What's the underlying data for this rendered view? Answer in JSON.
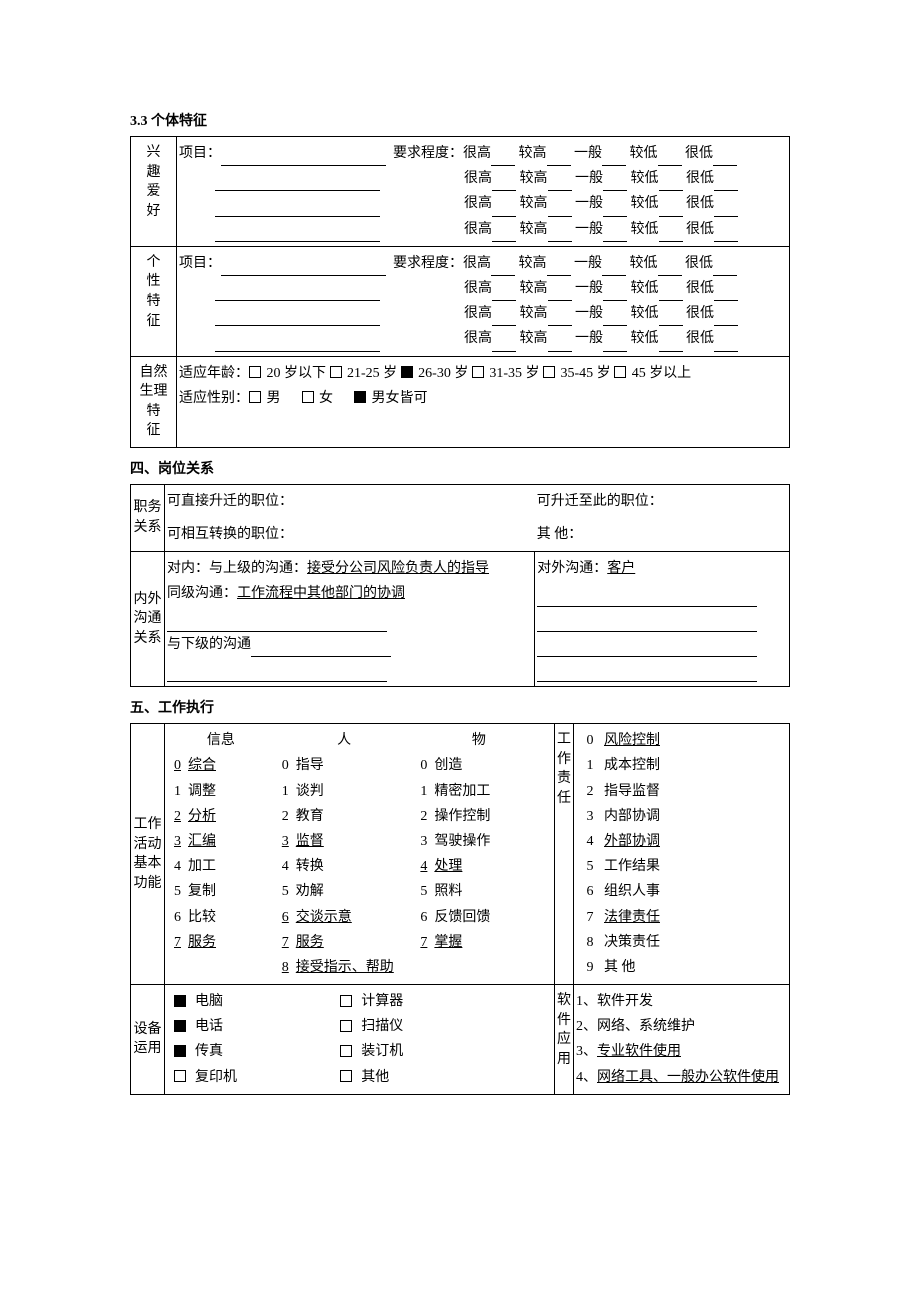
{
  "s33": {
    "title": "3.3 个体特征",
    "interest_label": "兴趣爱好",
    "personality_label": "个性特征",
    "project_label": "项目：",
    "require_label": "要求程度：",
    "levels": [
      "很高",
      "较高",
      "一般",
      "较低",
      "很低"
    ],
    "physio": {
      "label": "自然生理特征",
      "age_label": "适应年龄：",
      "ages": [
        "20 岁以下",
        "21-25 岁",
        "26-30 岁",
        "31-35 岁",
        "35-45 岁",
        "45 岁以上"
      ],
      "age_checked_index": 2,
      "sex_label": "适应性别：",
      "sexes": [
        "男",
        "女",
        "男女皆可"
      ],
      "sex_checked_index": 2
    }
  },
  "s4": {
    "title": "四、岗位关系",
    "job_rel_label": "职务关系",
    "direct_promo": "可直接升迁的职位：",
    "promo_to": "可升迁至此的职位：",
    "swap": "可相互转换的职位：",
    "other": "其        他：",
    "comm_label": "内外沟通关系",
    "internal_1a": "对内：与上级的沟通：",
    "internal_1b": "接受分公司风险负责人的指导",
    "internal_2a": "同级沟通：",
    "internal_2b": "工作流程中其他部门的协调",
    "internal_3a": "与下级的沟通",
    "external_1a": "对外沟通：",
    "external_1b": "客户"
  },
  "s5": {
    "title": "五、工作执行",
    "func_label": "工作活动基本功能",
    "func_headers": [
      "信息",
      "人",
      "物"
    ],
    "info_col": [
      {
        "n": "0",
        "t": "综合",
        "u": true
      },
      {
        "n": "1",
        "t": "调整",
        "u": false
      },
      {
        "n": "2",
        "t": "分析",
        "u": true
      },
      {
        "n": "3",
        "t": "汇编",
        "u": true
      },
      {
        "n": "4",
        "t": "加工",
        "u": false
      },
      {
        "n": "5",
        "t": "复制",
        "u": false
      },
      {
        "n": "6",
        "t": "比较",
        "u": false
      },
      {
        "n": "7",
        "t": "服务",
        "u": true
      }
    ],
    "people_col": [
      {
        "n": "0",
        "t": "指导",
        "u": false
      },
      {
        "n": "1",
        "t": "谈判",
        "u": false
      },
      {
        "n": "2",
        "t": "教育",
        "u": false
      },
      {
        "n": "3",
        "t": "监督",
        "u": true
      },
      {
        "n": "4",
        "t": "转换",
        "u": false
      },
      {
        "n": "5",
        "t": "劝解",
        "u": false
      },
      {
        "n": "6",
        "t": "交谈示意",
        "u": true
      },
      {
        "n": "7",
        "t": "服务",
        "u": true
      },
      {
        "n": "8",
        "t": "接受指示、帮助",
        "u": true
      }
    ],
    "thing_col": [
      {
        "n": "0",
        "t": "创造",
        "u": false
      },
      {
        "n": "1",
        "t": "精密加工",
        "u": false
      },
      {
        "n": "2",
        "t": "操作控制",
        "u": false
      },
      {
        "n": "3",
        "t": "驾驶操作",
        "u": false
      },
      {
        "n": "4",
        "t": "处理",
        "u": true
      },
      {
        "n": "5",
        "t": "照料",
        "u": false
      },
      {
        "n": "6",
        "t": "反馈回馈",
        "u": false
      },
      {
        "n": "7",
        "t": "掌握",
        "u": true
      }
    ],
    "resp_label": "工作责任",
    "resp_items": [
      {
        "n": "0",
        "t": "风险控制",
        "u": true
      },
      {
        "n": "1",
        "t": "成本控制",
        "u": false
      },
      {
        "n": "2",
        "t": "指导监督",
        "u": false
      },
      {
        "n": "3",
        "t": "内部协调",
        "u": false
      },
      {
        "n": "4",
        "t": "外部协调",
        "u": true
      },
      {
        "n": "5",
        "t": "工作结果",
        "u": false
      },
      {
        "n": "6",
        "t": "组织人事",
        "u": false
      },
      {
        "n": "7",
        "t": "法律责任",
        "u": true
      },
      {
        "n": "8",
        "t": "决策责任",
        "u": false
      },
      {
        "n": "9",
        "t": "其        他",
        "u": false
      }
    ],
    "equip_label": "设备运用",
    "equip_items": [
      {
        "t": "电脑",
        "c": true
      },
      {
        "t": "电话",
        "c": true
      },
      {
        "t": "传真",
        "c": true
      },
      {
        "t": "复印机",
        "c": false
      },
      {
        "t": "计算器",
        "c": false
      },
      {
        "t": "扫描仪",
        "c": false
      },
      {
        "t": "装订机",
        "c": false
      },
      {
        "t": "其他",
        "c": false
      }
    ],
    "sw_label": "软件应用",
    "sw_items": [
      {
        "n": "1、",
        "t": "软件开发",
        "u": false
      },
      {
        "n": "2、",
        "t": "网络、系统维护",
        "u": false
      },
      {
        "n": "3、",
        "t": "专业软件使用",
        "u": true
      },
      {
        "n": "4、",
        "t": "网络工具、一般办公软件使用",
        "u": true
      }
    ]
  }
}
